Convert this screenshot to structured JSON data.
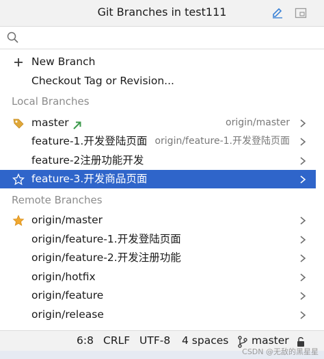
{
  "header": {
    "title": "Git Branches in test111"
  },
  "search": {
    "placeholder": "",
    "value": ""
  },
  "actions": [
    {
      "label": "New Branch",
      "icon": "plus-icon"
    },
    {
      "label": "Checkout Tag or Revision..."
    }
  ],
  "local_section": "Local Branches",
  "local_branches": [
    {
      "label": "master",
      "remote": "origin/master",
      "icon": "tag-icon",
      "marker": "outgoing-arrow-icon"
    },
    {
      "label": "feature-1.开发登陆页面",
      "remote": "origin/feature-1.开发登陆页面"
    },
    {
      "label": "feature-2注册功能开发",
      "remote": ""
    },
    {
      "label": "feature-3.开发商品页面",
      "remote": "",
      "icon": "star-outline-icon",
      "selected": true
    }
  ],
  "remote_section": "Remote Branches",
  "remote_branches": [
    {
      "label": "origin/master",
      "icon": "star-filled-icon"
    },
    {
      "label": "origin/feature-1.开发登陆页面"
    },
    {
      "label": "origin/feature-2.开发注册功能"
    },
    {
      "label": "origin/hotfix"
    },
    {
      "label": "origin/feature"
    },
    {
      "label": "origin/release"
    }
  ],
  "statusbar": {
    "position": "6:8",
    "line_sep": "CRLF",
    "encoding": "UTF-8",
    "indent": "4 spaces",
    "branch": "master"
  },
  "watermark": "CSDN @无敌的黑星星",
  "colors": {
    "selection": "#2f65ca",
    "section_text": "#8c8c8c",
    "remote_text": "#787878",
    "tag_icon": "#e0a83a",
    "arrow_icon": "#3d9a4c",
    "star_icon": "#f0a830"
  }
}
